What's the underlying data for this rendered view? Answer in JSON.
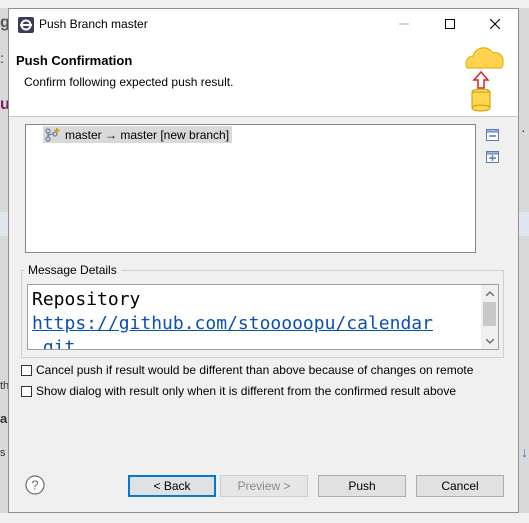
{
  "window": {
    "title": "Push Branch master"
  },
  "header": {
    "title": "Push Confirmation",
    "description": "Confirm following expected push result."
  },
  "tree": {
    "items": [
      {
        "label": "master → master [new branch]"
      }
    ]
  },
  "message_details": {
    "label": "Message Details",
    "lines": [
      "Repository",
      "https://github.com/stooooopu/calendar",
      ".git"
    ]
  },
  "options": {
    "cancel_push": {
      "label": "Cancel push if result would be different than above because of changes on remote",
      "checked": false
    },
    "show_dialog": {
      "label": "Show dialog with result only when it is different from the confirmed result above",
      "checked": false
    }
  },
  "buttons": {
    "back": "< Back",
    "preview": "Preview >",
    "push": "Push",
    "cancel": "Cancel"
  },
  "background": {
    "fragments": [
      "g",
      ":",
      "ub",
      "th",
      "a",
      "s"
    ]
  },
  "colors": {
    "accent": "#0078d7",
    "link": "#0a4fb4",
    "selection": "#d9d9d9"
  }
}
